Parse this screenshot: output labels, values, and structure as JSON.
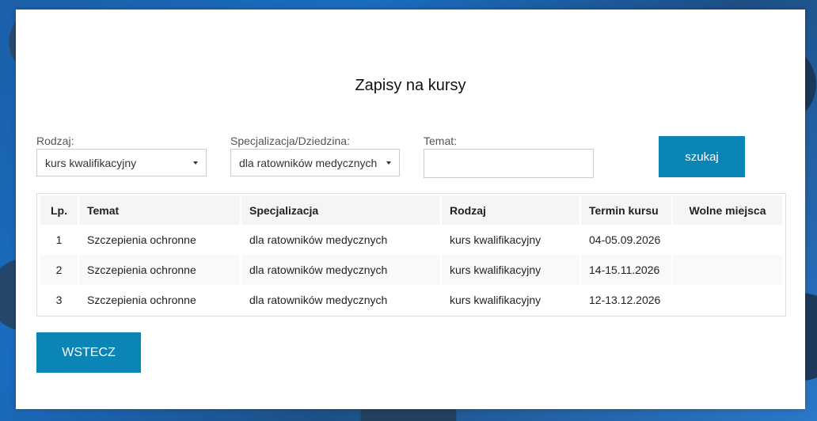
{
  "page": {
    "title": "Zapisy na kursy"
  },
  "filters": {
    "rodzaj_label": "Rodzaj:",
    "rodzaj_value": "kurs kwalifikacyjny",
    "specjalizacja_label": "Specjalizacja/Dziedzina:",
    "specjalizacja_value": "dla ratowników medycznych",
    "temat_label": "Temat:",
    "temat_value": "",
    "search_label": "szukaj"
  },
  "table": {
    "headers": {
      "lp": "Lp.",
      "temat": "Temat",
      "specjalizacja": "Specjalizacja",
      "rodzaj": "Rodzaj",
      "termin": "Termin kursu",
      "wolne": "Wolne miejsca"
    },
    "rows": [
      {
        "lp": "1",
        "temat": "Szczepienia ochronne",
        "specjalizacja": "dla ratowników medycznych",
        "rodzaj": "kurs kwalifikacyjny",
        "termin": "04-05.09.2026",
        "wolne": ""
      },
      {
        "lp": "2",
        "temat": "Szczepienia ochronne",
        "specjalizacja": "dla ratowników medycznych",
        "rodzaj": "kurs kwalifikacyjny",
        "termin": "14-15.11.2026",
        "wolne": ""
      },
      {
        "lp": "3",
        "temat": "Szczepienia ochronne",
        "specjalizacja": "dla ratowników medycznych",
        "rodzaj": "kurs kwalifikacyjny",
        "termin": "12-13.12.2026",
        "wolne": ""
      }
    ]
  },
  "footer": {
    "back_label": "WSTECZ"
  },
  "colors": {
    "accent": "#0b84b6",
    "header_bg": "#f5f5f5"
  }
}
